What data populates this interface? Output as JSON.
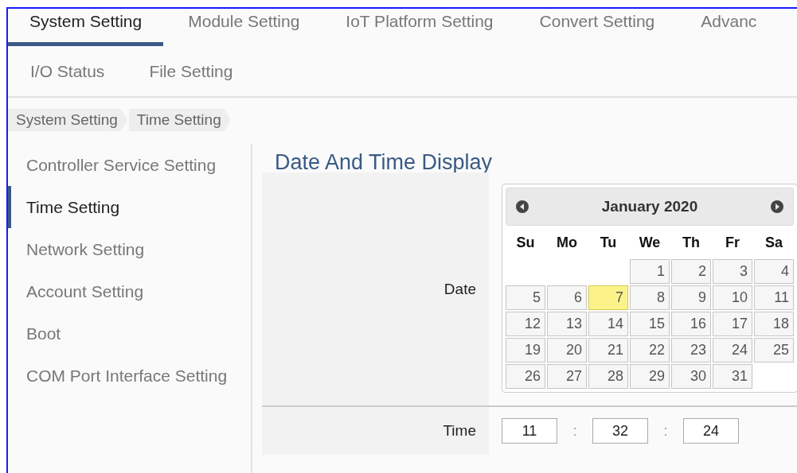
{
  "main_tabs": [
    {
      "label": "System Setting",
      "selected": true
    },
    {
      "label": "Module Setting",
      "selected": false
    },
    {
      "label": "IoT Platform Setting",
      "selected": false
    },
    {
      "label": "Convert Setting",
      "selected": false
    },
    {
      "label": "Advanc",
      "selected": false
    }
  ],
  "sub_tabs": [
    {
      "label": "I/O Status"
    },
    {
      "label": "File Setting"
    }
  ],
  "breadcrumb": [
    "System Setting",
    "Time Setting"
  ],
  "sidebar": {
    "items": [
      {
        "label": "Controller Service Setting",
        "selected": false
      },
      {
        "label": "Time Setting",
        "selected": true
      },
      {
        "label": "Network Setting",
        "selected": false
      },
      {
        "label": "Account Setting",
        "selected": false
      },
      {
        "label": "Boot",
        "selected": false
      },
      {
        "label": "COM Port Interface Setting",
        "selected": false
      }
    ]
  },
  "section_title": "Date And Time Display",
  "date_row": {
    "label": "Date",
    "calendar": {
      "month": "January 2020",
      "weekdays": [
        "Su",
        "Mo",
        "Tu",
        "We",
        "Th",
        "Fr",
        "Sa"
      ],
      "weeks": [
        [
          {
            "day": "1",
            "selected": false
          },
          {
            "day": "2",
            "selected": false
          },
          {
            "day": "3",
            "selected": false
          },
          {
            "day": "4",
            "selected": false
          }
        ],
        [
          {
            "day": "5",
            "selected": false
          },
          {
            "day": "6",
            "selected": false
          },
          {
            "day": "7",
            "selected": true
          },
          {
            "day": "8",
            "selected": false
          },
          {
            "day": "9",
            "selected": false
          },
          {
            "day": "10",
            "selected": false
          },
          {
            "day": "11",
            "selected": false
          }
        ],
        [
          {
            "day": "12",
            "selected": false
          },
          {
            "day": "13",
            "selected": false
          },
          {
            "day": "14",
            "selected": false
          },
          {
            "day": "15",
            "selected": false
          },
          {
            "day": "16",
            "selected": false
          },
          {
            "day": "17",
            "selected": false
          },
          {
            "day": "18",
            "selected": false
          }
        ],
        [
          {
            "day": "19",
            "selected": false
          },
          {
            "day": "20",
            "selected": false
          },
          {
            "day": "21",
            "selected": false
          },
          {
            "day": "22",
            "selected": false
          },
          {
            "day": "23",
            "selected": false
          },
          {
            "day": "24",
            "selected": false
          },
          {
            "day": "25",
            "selected": false
          }
        ],
        [
          {
            "day": "26",
            "selected": false
          },
          {
            "day": "27",
            "selected": false
          },
          {
            "day": "28",
            "selected": false
          },
          {
            "day": "29",
            "selected": false
          },
          {
            "day": "30",
            "selected": false
          },
          {
            "day": "31",
            "selected": false
          }
        ]
      ]
    }
  },
  "time_row": {
    "label": "Time",
    "fields": [
      {
        "value": "11"
      },
      {
        "value": "32"
      },
      {
        "value": "24"
      }
    ],
    "separators": [
      ":",
      ":"
    ]
  }
}
